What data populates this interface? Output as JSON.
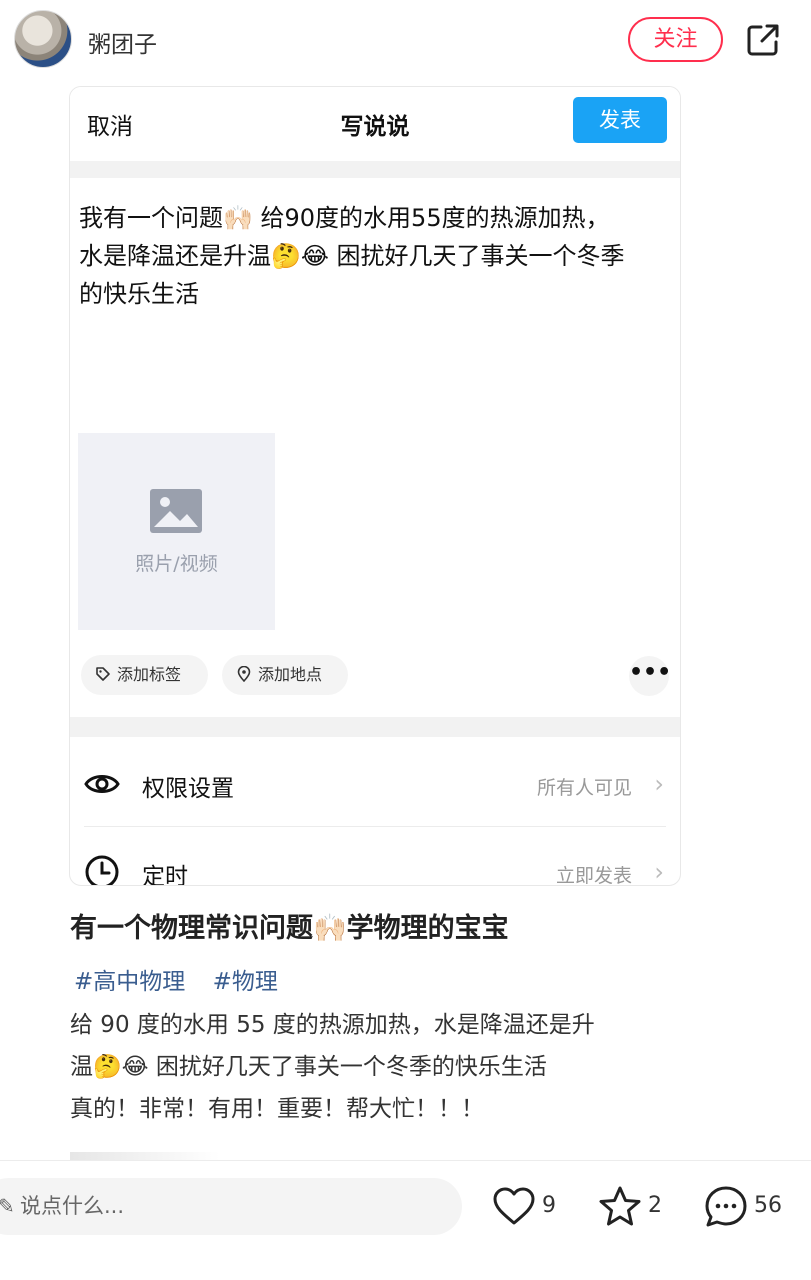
{
  "header": {
    "username": "粥团子",
    "follow_label": "关注"
  },
  "editor": {
    "cancel_label": "取消",
    "title": "写说说",
    "publish_label": "发表",
    "post_line1": "我有一个问题🙌🏻 给90度的水用55度的热源加热，",
    "post_line2": "水是降温还是升温🤔😂 困扰好几天了事关一个冬季",
    "post_line3": "的快乐生活",
    "photo_label": "照片/视频",
    "tag_chip": "添加标签",
    "location_chip": "添加地点",
    "more_label": "•••",
    "rows": [
      {
        "label": "权限设置",
        "value": "所有人可见",
        "icon": "eye-icon"
      },
      {
        "label": "定时",
        "value": "立即发表",
        "icon": "clock-icon"
      }
    ]
  },
  "post": {
    "title": "有一个物理常识问题🙌🏻学物理的宝宝",
    "tags": [
      "#高中物理",
      "#物理"
    ],
    "body_line1": "给 90 度的水用 55 度的热源加热，水是降温还是升",
    "body_line2": "温🤔😂 困扰好几天了事关一个冬季的快乐生活",
    "body_line3": "真的！非常！有用！重要！帮大忙！！！"
  },
  "bottom_bar": {
    "comment_placeholder": "说点什么...",
    "likes": "9",
    "favorites": "2",
    "comments": "56"
  },
  "colors": {
    "follow_red": "#ff2e4d",
    "publish_blue": "#1aa3f5",
    "tag_blue": "#3a5d8f"
  }
}
